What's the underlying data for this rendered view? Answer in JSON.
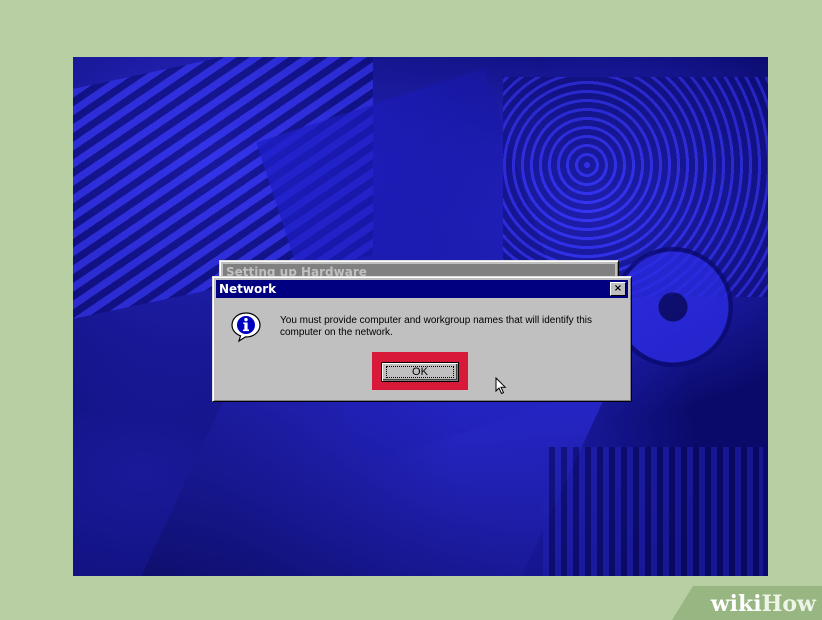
{
  "background_window": {
    "title": "Setting up Hardware"
  },
  "dialog": {
    "title": "Network",
    "close_glyph": "×",
    "message": "You must provide computer and workgroup names that will identify this computer on the network.",
    "ok_label": "OK",
    "icon": "info-icon",
    "highlight_color": "#d8193a"
  },
  "watermark": {
    "part1": "wiki",
    "part2": "How"
  }
}
